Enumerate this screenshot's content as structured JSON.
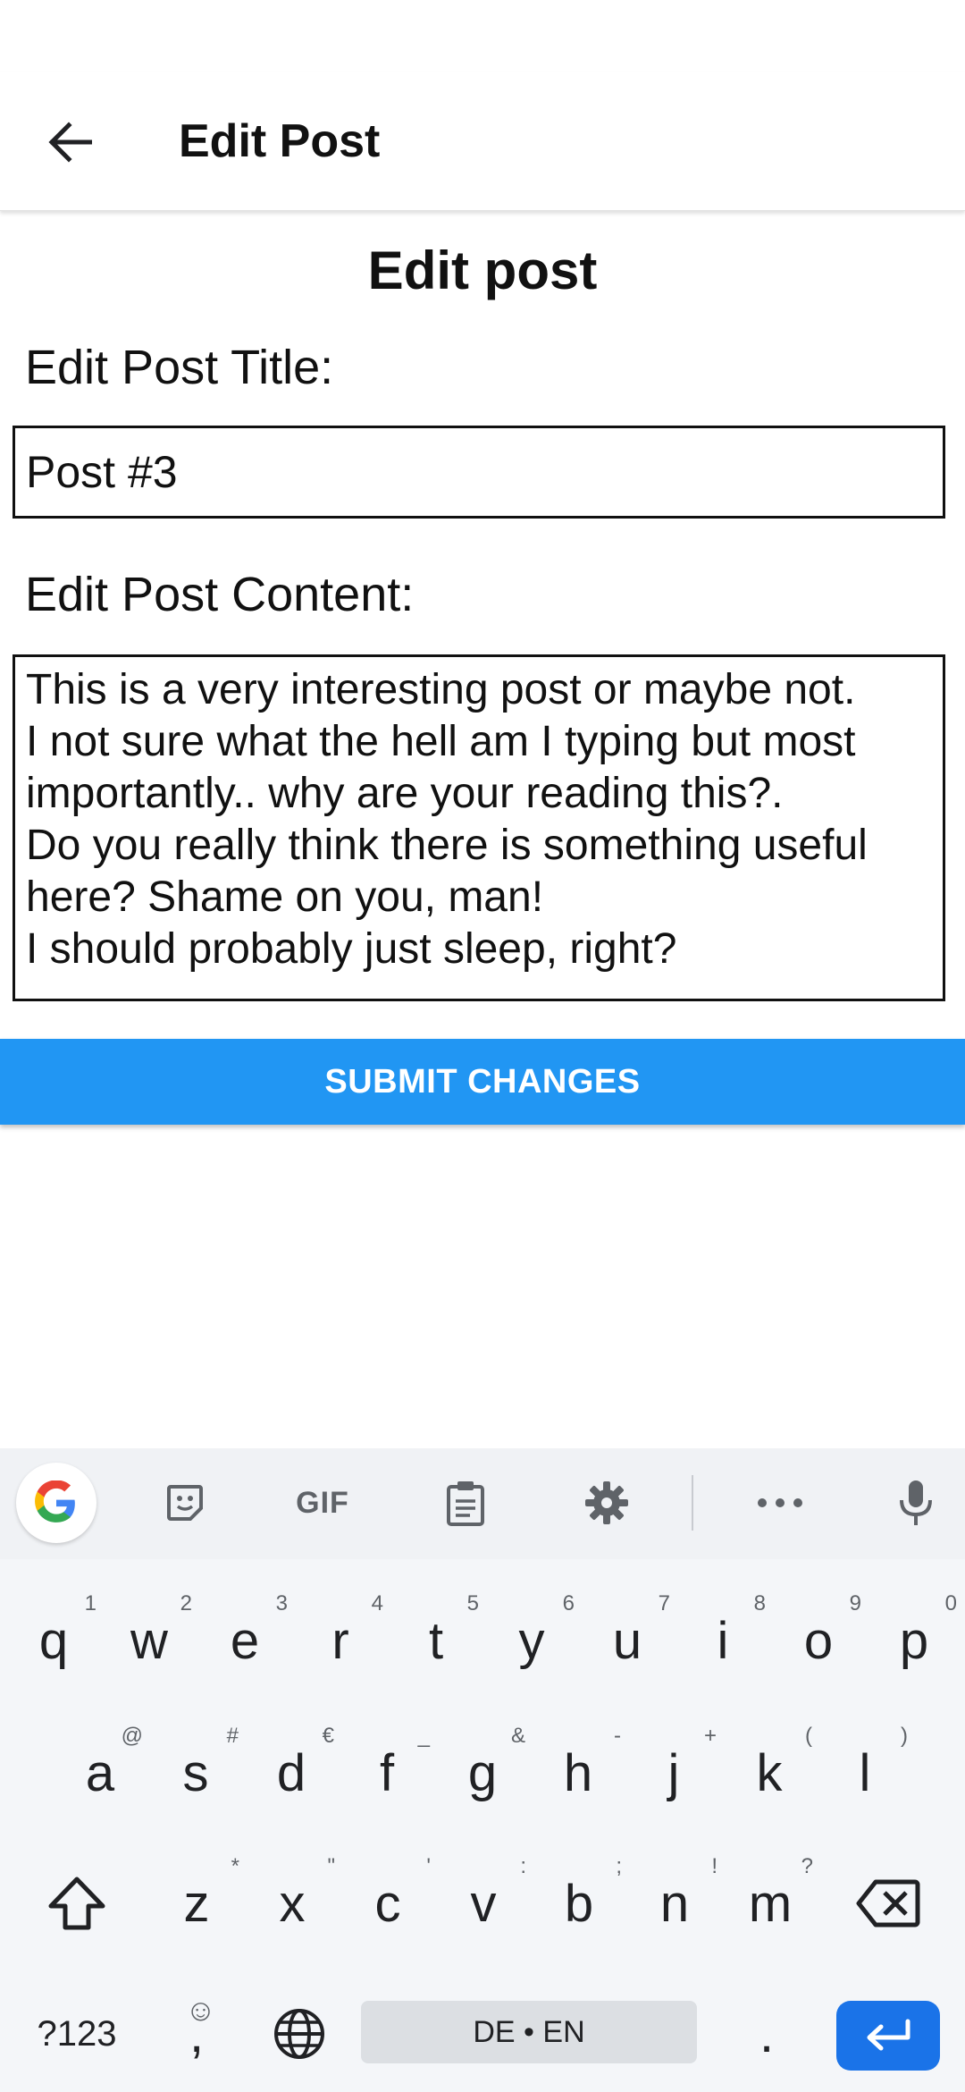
{
  "appbar": {
    "title": "Edit Post",
    "back_icon": "arrow-back-icon"
  },
  "page": {
    "heading": "Edit post"
  },
  "form": {
    "title_label": "Edit Post Title:",
    "title_value": "Post #3",
    "content_label": "Edit Post Content:",
    "content_value": "This is a very interesting post or maybe not.\nI not sure what the hell am I typing but most importantly.. why are your reading this?.\nDo you really think there is something useful here? Shame on you, man!\nI should probably just sleep, right?",
    "submit_label": "SUBMIT CHANGES"
  },
  "colors": {
    "accent": "#2196f3",
    "keyboard_enter": "#1a73e8",
    "keyboard_bg": "#f0f2f5"
  },
  "keyboard": {
    "toolbar": {
      "gif_label": "GIF",
      "icons": [
        "google-icon",
        "sticker-icon",
        "gif-icon",
        "clipboard-icon",
        "settings-icon",
        "more-icon",
        "mic-icon"
      ]
    },
    "row1": [
      {
        "k": "q",
        "h": "1"
      },
      {
        "k": "w",
        "h": "2"
      },
      {
        "k": "e",
        "h": "3"
      },
      {
        "k": "r",
        "h": "4"
      },
      {
        "k": "t",
        "h": "5"
      },
      {
        "k": "y",
        "h": "6"
      },
      {
        "k": "u",
        "h": "7"
      },
      {
        "k": "i",
        "h": "8"
      },
      {
        "k": "o",
        "h": "9"
      },
      {
        "k": "p",
        "h": "0"
      }
    ],
    "row2": [
      {
        "k": "a",
        "h": "@"
      },
      {
        "k": "s",
        "h": "#"
      },
      {
        "k": "d",
        "h": "€"
      },
      {
        "k": "f",
        "h": "_"
      },
      {
        "k": "g",
        "h": "&"
      },
      {
        "k": "h",
        "h": "-"
      },
      {
        "k": "j",
        "h": "+"
      },
      {
        "k": "k",
        "h": "("
      },
      {
        "k": "l",
        "h": ")"
      }
    ],
    "row3": [
      {
        "k": "z",
        "h": "*"
      },
      {
        "k": "x",
        "h": "\""
      },
      {
        "k": "c",
        "h": "'"
      },
      {
        "k": "v",
        "h": ":"
      },
      {
        "k": "b",
        "h": ";"
      },
      {
        "k": "n",
        "h": "!"
      },
      {
        "k": "m",
        "h": "?"
      }
    ],
    "symbols_label": "?123",
    "comma_label": ",",
    "emoji_hint": "☺",
    "space_label": "DE • EN",
    "period_label": "."
  }
}
